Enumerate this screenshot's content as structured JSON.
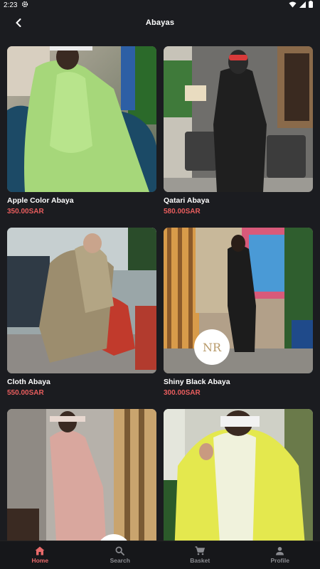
{
  "status_bar": {
    "time": "2:23"
  },
  "app_bar": {
    "title": "Abayas"
  },
  "products": [
    {
      "name": "Apple Color Abaya",
      "price": "350.00SAR"
    },
    {
      "name": "Qatari Abaya",
      "price": "580.00SAR"
    },
    {
      "name": "Cloth Abaya",
      "price": "550.00SAR"
    },
    {
      "name": "Shiny Black Abaya",
      "price": "300.00SAR"
    },
    {
      "name": "",
      "price": ""
    },
    {
      "name": "",
      "price": ""
    }
  ],
  "bottom_nav": {
    "items": [
      {
        "label": "Home",
        "icon": "home-icon",
        "active": true
      },
      {
        "label": "Search",
        "icon": "search-icon",
        "active": false
      },
      {
        "label": "Basket",
        "icon": "cart-icon",
        "active": false
      },
      {
        "label": "Profile",
        "icon": "person-icon",
        "active": false
      }
    ]
  },
  "colors": {
    "background": "#1b1c20",
    "price": "#e85d5d",
    "active_nav": "#e86a6a",
    "inactive_nav": "#8a8b90"
  }
}
